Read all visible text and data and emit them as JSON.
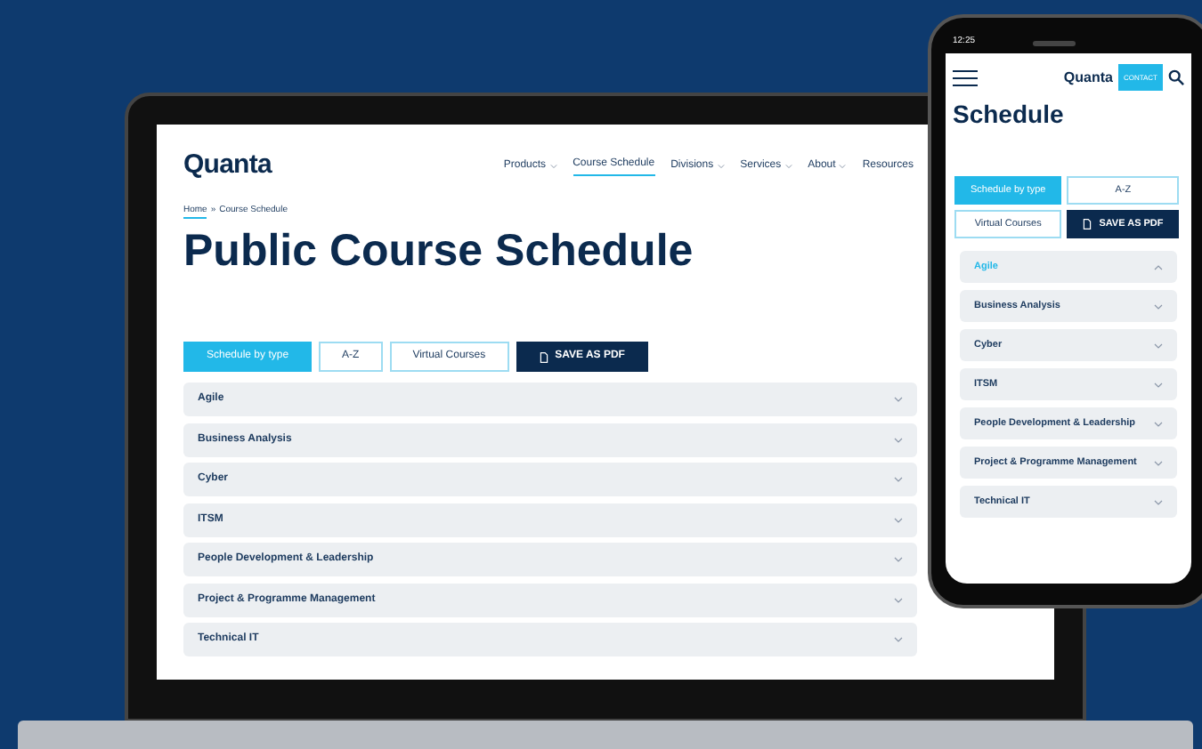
{
  "laptop": {
    "logo": "Quanta",
    "nav": [
      {
        "label": "Products",
        "dropdown": true,
        "selected": false
      },
      {
        "label": "Course Schedule",
        "dropdown": false,
        "selected": true
      },
      {
        "label": "Divisions",
        "dropdown": true,
        "selected": false
      },
      {
        "label": "Services",
        "dropdown": true,
        "selected": false
      },
      {
        "label": "About",
        "dropdown": true,
        "selected": false
      },
      {
        "label": "Resources",
        "dropdown": false,
        "selected": false
      }
    ],
    "breadcrumb": [
      "Home",
      "Course Schedule"
    ],
    "breadcrumb_separator": "»",
    "title": "Public Course Schedule",
    "buttons": [
      {
        "label": "Schedule by type",
        "kind": "tab",
        "selected": true
      },
      {
        "label": "A-Z",
        "kind": "tab",
        "selected": false
      },
      {
        "label": "Virtual Courses",
        "kind": "tab",
        "selected": false
      },
      {
        "label": "SAVE AS PDF",
        "kind": "pdf"
      }
    ],
    "categories": [
      {
        "label": "Agile",
        "expanded": false
      },
      {
        "label": "Business Analysis",
        "expanded": false
      },
      {
        "label": "Cyber",
        "expanded": false
      },
      {
        "label": "ITSM",
        "expanded": false
      },
      {
        "label": "People Development & Leadership",
        "expanded": false
      },
      {
        "label": "Project & Programme Management",
        "expanded": false
      },
      {
        "label": "Technical IT",
        "expanded": false
      }
    ]
  },
  "phone": {
    "time": "12:25",
    "logo": "Quanta",
    "contact": "CONTACT",
    "title": "Schedule",
    "buttons": [
      {
        "label": "Schedule by type",
        "kind": "tab",
        "selected": true
      },
      {
        "label": "A-Z",
        "kind": "tab",
        "selected": false
      },
      {
        "label": "Virtual Courses",
        "kind": "tab",
        "selected": false
      },
      {
        "label": "SAVE AS PDF",
        "kind": "pdf"
      }
    ],
    "categories": [
      {
        "label": "Agile",
        "expanded": true
      },
      {
        "label": "Business Analysis",
        "expanded": false
      },
      {
        "label": "Cyber",
        "expanded": false
      },
      {
        "label": "ITSM",
        "expanded": false
      },
      {
        "label": "People Development & Leadership",
        "expanded": false
      },
      {
        "label": "Project & Programme Management",
        "expanded": false
      },
      {
        "label": "Technical IT",
        "expanded": false
      }
    ]
  }
}
